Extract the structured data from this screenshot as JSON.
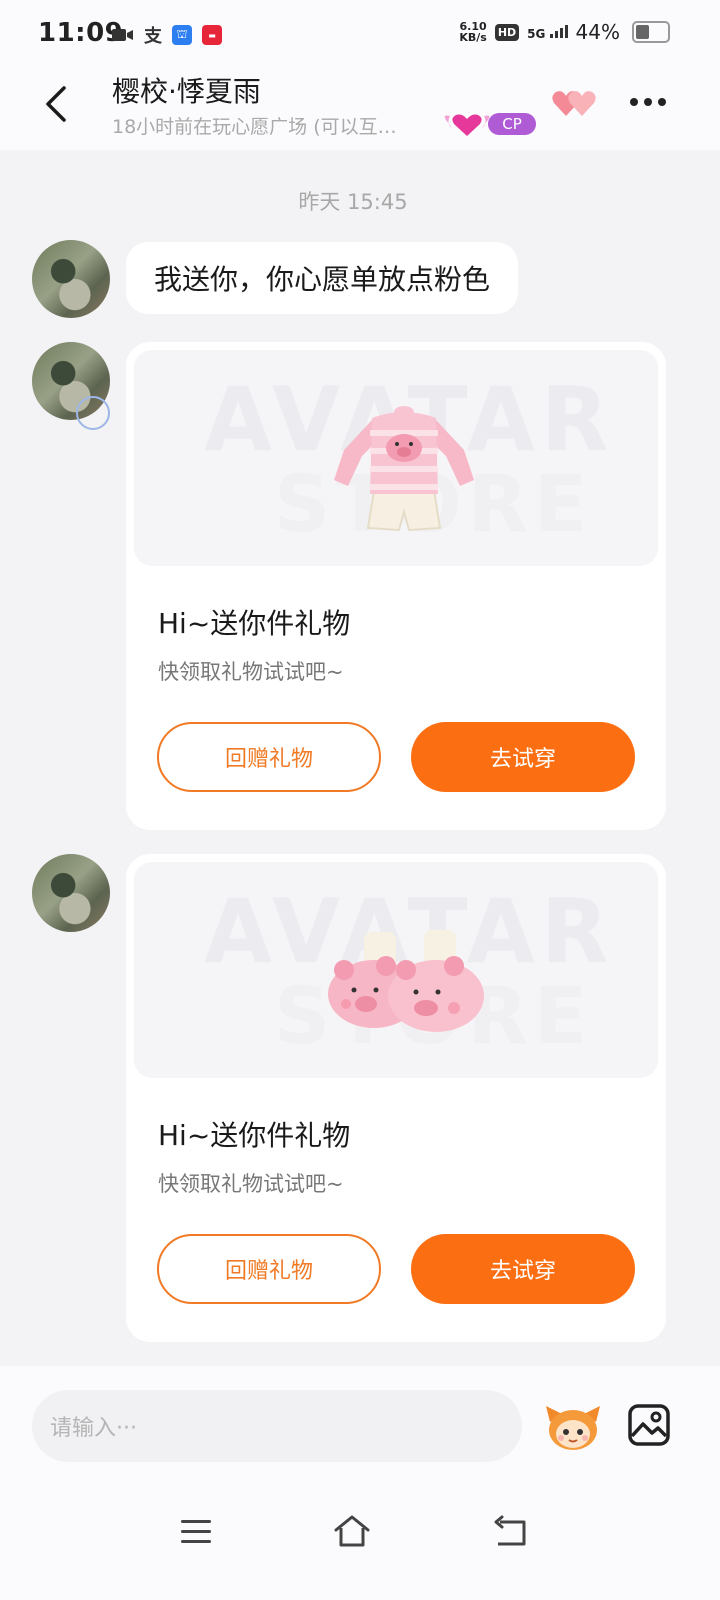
{
  "status_bar": {
    "time": "11:09",
    "net_speed_value": "6.10",
    "net_speed_unit": "KB/s",
    "hd": "HD",
    "signal": "5G",
    "battery": "44%",
    "battery_level": 0.44
  },
  "header": {
    "title": "樱校·悸夏雨",
    "subtitle": "18小时前在玩心愿广场 (可以互…",
    "cp_label": "CP"
  },
  "chat": {
    "timestamp": "昨天 15:45",
    "message_text": "我送你，你心愿单放点粉色",
    "cards": [
      {
        "watermark_line1": "AVATAR",
        "watermark_line2": "STORE",
        "item": "pink-striped-pajamas",
        "title": "Hi~送你件礼物",
        "subtitle": "快领取礼物试试吧~",
        "return_gift_label": "回赠礼物",
        "try_on_label": "去试穿"
      },
      {
        "watermark_line1": "AVATAR",
        "watermark_line2": "STORE",
        "item": "pink-pig-slippers",
        "title": "Hi~送你件礼物",
        "subtitle": "快领取礼物试试吧~",
        "return_gift_label": "回赠礼物",
        "try_on_label": "去试穿"
      }
    ]
  },
  "input_bar": {
    "placeholder": "请输入···"
  },
  "colors": {
    "accent": "#fb6f12",
    "outline": "#f07a25",
    "background": "#f3f3f5"
  }
}
